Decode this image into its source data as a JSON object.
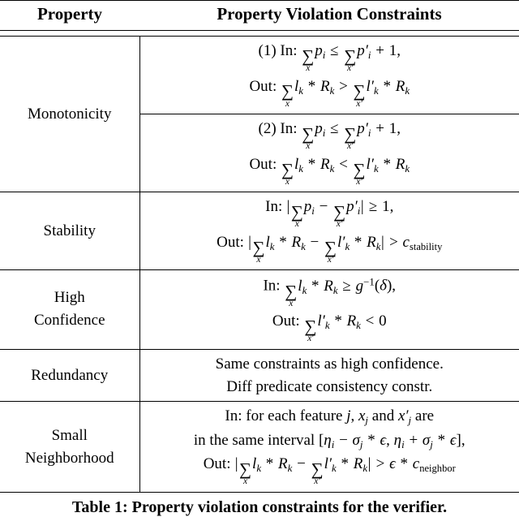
{
  "table": {
    "headers": {
      "property": "Property",
      "constraints": "Property Violation Constraints"
    },
    "rows": [
      {
        "property": "Monotonicity",
        "blocks": [
          {
            "label": "(1)",
            "in": "In: ∑x p_i ≤ ∑x' p'_i + 1,",
            "out": "Out: ∑x l_k * R_k > ∑x' l'_k * R_k"
          },
          {
            "label": "(2)",
            "in": "In: ∑x p_i ≤ ∑x' p'_i + 1,",
            "out": "Out: ∑x l_k * R_k < ∑x' l'_k * R_k"
          }
        ]
      },
      {
        "property": "Stability",
        "blocks": [
          {
            "label": "",
            "in": "In: |∑x p_i − ∑x' p'_i| ≥ 1,",
            "out": "Out: |∑x l_k * R_k − ∑x' l'_k * R_k| > c_stability"
          }
        ]
      },
      {
        "property": "High Confidence",
        "blocks": [
          {
            "label": "",
            "in": "In: ∑x l_k * R_k ≥ g^{-1}(δ),",
            "out": "Out: ∑x' l'_k * R_k < 0"
          }
        ]
      },
      {
        "property": "Redundancy",
        "blocks": [
          {
            "label": "",
            "in": "Same constraints as high confidence.",
            "out": "Diff predicate consistency constr."
          }
        ]
      },
      {
        "property": "Small Neighborhood",
        "blocks": [
          {
            "label": "",
            "in": "In: for each feature j, x_j and x'_j are in the same interval [η_i − σ_j * ϵ, η_i + σ_j * ϵ],",
            "out": "Out: |∑x l_k * R_k − ∑x' l'_k * R_k| > ϵ * c_neighbor"
          }
        ]
      }
    ],
    "property_labels": {
      "monotonicity": "Monotonicity",
      "stability": "Stability",
      "high_confidence_line1": "High",
      "high_confidence_line2": "Confidence",
      "redundancy": "Redundancy",
      "small_neighborhood_line1": "Small",
      "small_neighborhood_line2": "Neighborhood"
    },
    "redundancy_text": {
      "line1": "Same constraints as high confidence.",
      "line2": "Diff predicate consistency constr."
    },
    "markers": {
      "one": "(1)",
      "two": "(2)"
    },
    "keywords": {
      "in": "In:",
      "out": "Out:",
      "for_each_feature": "for each feature",
      "and": "and",
      "are": "are",
      "in_the_same_interval": "in the same interval"
    },
    "symbols": {
      "sum": "∑",
      "leq": "≤",
      "geq": "≥",
      "gt": ">",
      "lt": "<",
      "minus": "−",
      "plus": "+",
      "times": "*",
      "delta": "δ",
      "eta": "η",
      "sigma": "σ",
      "epsilon": "ϵ",
      "abs": "|",
      "one": "1",
      "zero": "0",
      "comma": ",",
      "c_stability_sub": "stability",
      "c_neighbor_sub": "neighbor"
    }
  },
  "caption": "Table 1: Property violation constraints for the verifier."
}
